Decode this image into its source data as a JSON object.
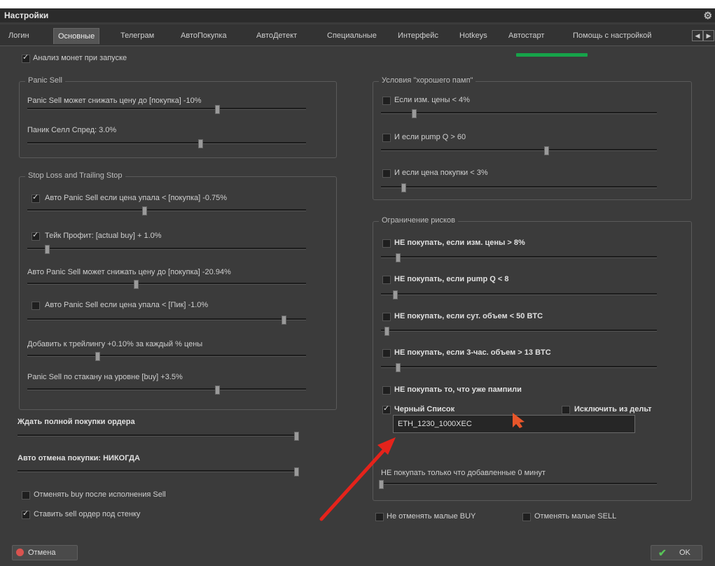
{
  "window": {
    "title": "Настройки"
  },
  "tabs": [
    {
      "label": "Логин"
    },
    {
      "label": "Основные"
    },
    {
      "label": "Телеграм"
    },
    {
      "label": "АвтоПокупка"
    },
    {
      "label": "АвтоДетект"
    },
    {
      "label": "Специальные"
    },
    {
      "label": "Интерфейс"
    },
    {
      "label": "Hotkeys"
    },
    {
      "label": "Автостарт"
    },
    {
      "label": "Помощь с настройкой"
    }
  ],
  "analyze_on_start": {
    "label": "Анализ монет при запуске",
    "checked": true
  },
  "panic_sell": {
    "title": "Panic Sell",
    "items": [
      {
        "label": "Panic Sell может снижать цену до [покупка] -10%",
        "value": 0.68
      },
      {
        "label": "Паник Селл Спред: 3.0%",
        "value": 0.62
      }
    ]
  },
  "stop_loss": {
    "title": "Stop Loss and Trailing Stop",
    "items": [
      {
        "label": "Авто Panic Sell если цена упала < [покупка] -0.75%",
        "checked": true,
        "value": 0.42
      },
      {
        "label": "Тейк Профит: [actual buy] + 1.0%",
        "checked": true,
        "value": 0.07
      },
      {
        "label": "Авто Panic Sell может снижать цену до [покупка] -20.94%",
        "value": 0.39
      },
      {
        "label": "Авто Panic Sell если цена упала < [Пик] -1.0%",
        "checked": false,
        "value": 0.92
      },
      {
        "label": "Добавить к трейлингу +0.10% за каждый % цены",
        "value": 0.25
      },
      {
        "label": "Panic Sell по стакану на уровне [buy] +3.5%",
        "value": 0.68
      }
    ]
  },
  "wait_full_buy": {
    "label": "Ждать полной покупки ордера",
    "value": 1.0
  },
  "auto_cancel_buy": {
    "label": "Авто отмена покупки: НИКОГДА",
    "value": 1.0
  },
  "cancel_buy_after_sell": {
    "label": "Отменять buy после исполнения Sell",
    "checked": false
  },
  "place_sell_under_wall": {
    "label": "Ставить sell ордер под стенку",
    "checked": true
  },
  "good_pump": {
    "title": "Условия \"хорошего памп\"",
    "items": [
      {
        "label": "Если изм. цены < 4%",
        "checked": false,
        "value": 0.12
      },
      {
        "label": "И если pump Q > 60",
        "checked": false,
        "value": 0.6
      },
      {
        "label": "И если цена покупки < 3%",
        "checked": false,
        "value": 0.08
      }
    ]
  },
  "risk_limit": {
    "title": "Ограничение рисков",
    "items": [
      {
        "label": "НЕ покупать, если изм. цены > 8%",
        "checked": false,
        "value": 0.06
      },
      {
        "label": "НЕ покупать, если pump Q < 8",
        "checked": false,
        "value": 0.05
      },
      {
        "label": "НЕ покупать, если сут. объем < 50 BTC",
        "checked": false,
        "value": 0.02
      },
      {
        "label": "НЕ покупать, если 3-час. объем > 13 BTC",
        "checked": false,
        "value": 0.06
      }
    ],
    "dont_buy_pumped": {
      "label": "НЕ покупать то, что уже пампили",
      "checked": false
    },
    "blacklist": {
      "label": "Черный Список",
      "checked": true
    },
    "exclude_delta": {
      "label": "Исключить из дельт",
      "checked": false
    },
    "blacklist_value": "ETH_1230_1000XEC",
    "dont_buy_recent": {
      "label": "НЕ покупать только что добавленные 0 минут",
      "value": 0.0
    }
  },
  "dont_cancel_manual_buy": {
    "label": "Не отменять малые BUY",
    "checked": false
  },
  "cancel_manual_sell": {
    "label": "Отменять малые SELL",
    "checked": false
  },
  "buttons": {
    "cancel": "Отмена",
    "ok": "OK"
  },
  "colors": {
    "bg": "#3b3b3b",
    "green_bar": "#16a34a",
    "arrow": "#e5231b",
    "cursor": "#e8562a"
  }
}
